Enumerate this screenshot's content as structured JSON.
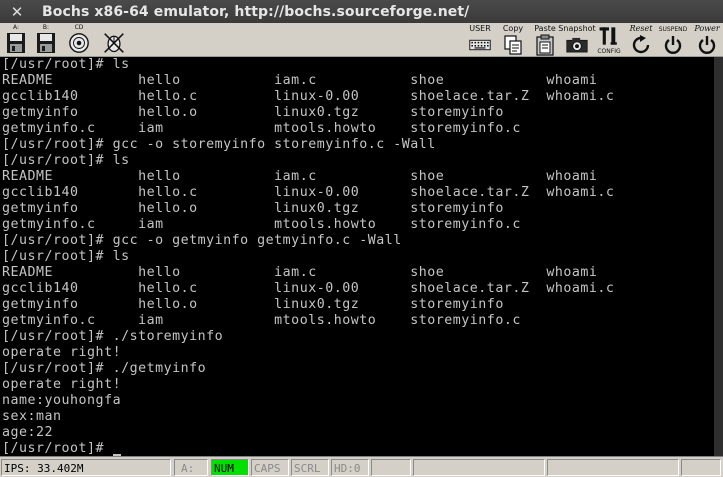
{
  "window": {
    "title": "Bochs x86-64 emulator, http://bochs.sourceforge.net/",
    "close_glyph": "✕"
  },
  "toolbar": {
    "left": [
      {
        "name": "floppy-a-button",
        "label": "A:",
        "icon": "floppy-icon"
      },
      {
        "name": "floppy-b-button",
        "label": "B:",
        "icon": "floppy-icon"
      },
      {
        "name": "cdrom-button",
        "label": "CD",
        "icon": "cdrom-icon"
      },
      {
        "name": "mouse-button",
        "label": "",
        "icon": "mouse-icon"
      }
    ],
    "right": [
      {
        "name": "user-button",
        "label": "USER",
        "icon": "keyboard-icon"
      },
      {
        "name": "copy-button",
        "label": "Copy",
        "icon": "copy-icon"
      },
      {
        "name": "paste-button",
        "label": "Paste",
        "icon": "paste-icon"
      },
      {
        "name": "snapshot-button",
        "label": "Snapshot",
        "icon": "camera-icon"
      },
      {
        "name": "config-button",
        "label": "CONFIG",
        "icon": "config-icon"
      },
      {
        "name": "reset-button",
        "label": "Reset",
        "icon": "reset-icon"
      },
      {
        "name": "suspend-button",
        "label": "SUSPEND",
        "icon": "suspend-icon"
      },
      {
        "name": "power-button",
        "label": "Power",
        "icon": "power-icon"
      }
    ]
  },
  "terminal": {
    "lines": [
      "[/usr/root]# ls",
      "README          hello           iam.c           shoe            whoami",
      "gcclib140       hello.c         linux-0.00      shoelace.tar.Z  whoami.c",
      "getmyinfo       hello.o         linux0.tgz      storemyinfo",
      "getmyinfo.c     iam             mtools.howto    storemyinfo.c",
      "[/usr/root]# gcc -o storemyinfo storemyinfo.c -Wall",
      "[/usr/root]# ls",
      "README          hello           iam.c           shoe            whoami",
      "gcclib140       hello.c         linux-0.00      shoelace.tar.Z  whoami.c",
      "getmyinfo       hello.o         linux0.tgz      storemyinfo",
      "getmyinfo.c     iam             mtools.howto    storemyinfo.c",
      "[/usr/root]# gcc -o getmyinfo getmyinfo.c -Wall",
      "[/usr/root]# ls",
      "README          hello           iam.c           shoe            whoami",
      "gcclib140       hello.c         linux-0.00      shoelace.tar.Z  whoami.c",
      "getmyinfo       hello.o         linux0.tgz      storemyinfo",
      "getmyinfo.c     iam             mtools.howto    storemyinfo.c",
      "[/usr/root]# ./storemyinfo",
      "operate right!",
      "[/usr/root]# ./getmyinfo",
      "operate right!",
      "name:youhongfa",
      "sex:man",
      "age:22",
      "[/usr/root]# "
    ]
  },
  "statusbar": {
    "ips": "IPS: 33.402M",
    "drive": "A:",
    "num": "NUM",
    "caps": "CAPS",
    "scrl": "SCRL",
    "hd": "HD:0"
  },
  "colors": {
    "terminal_text": "#c4c4c4",
    "num_indicator": "#00e000",
    "toolbar_bg": "#d4d0c8"
  }
}
